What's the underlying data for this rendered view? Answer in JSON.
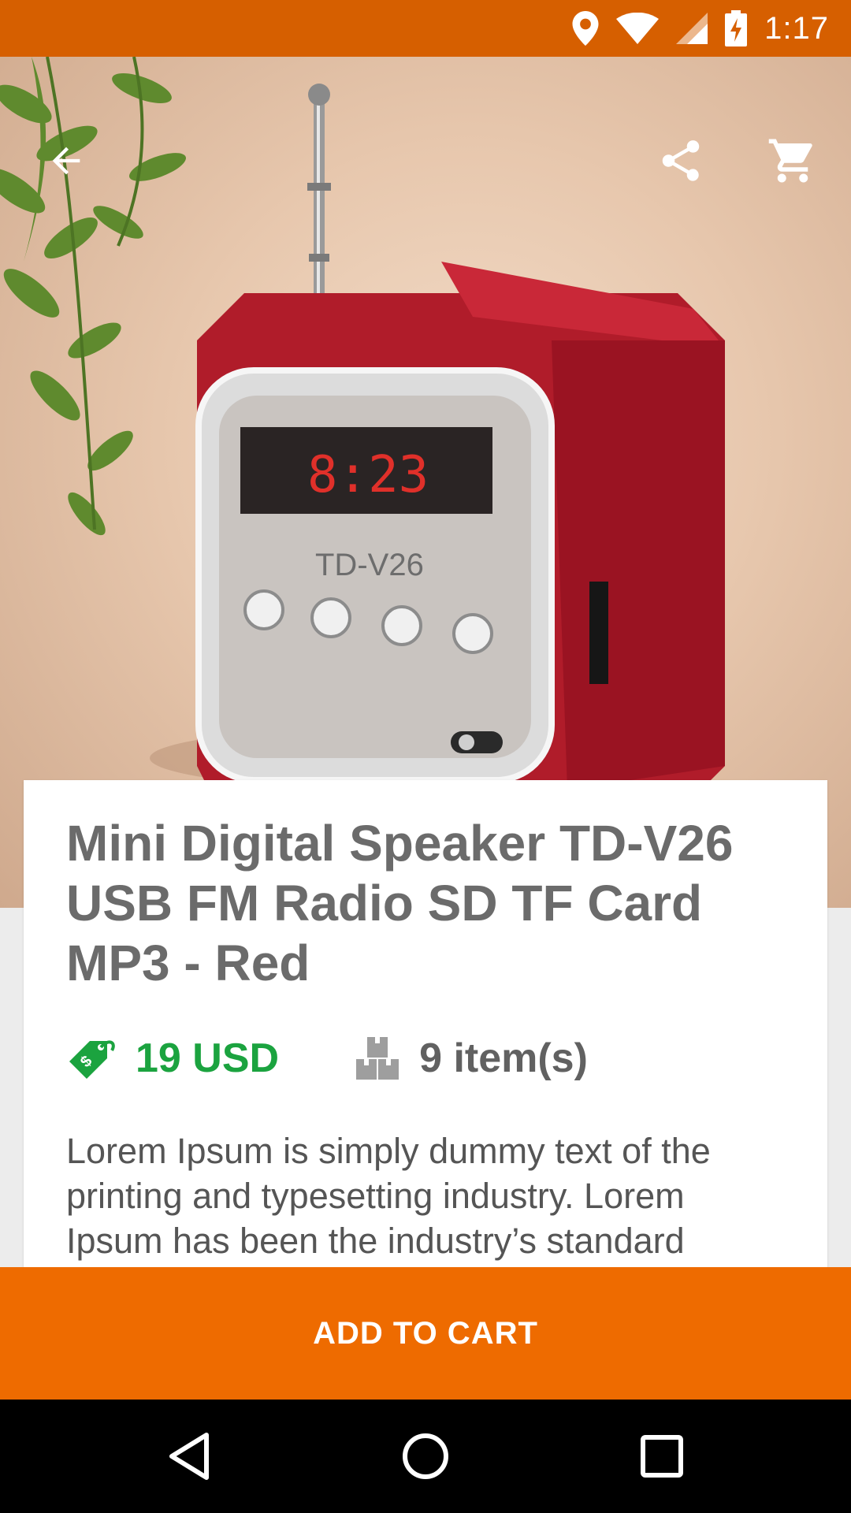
{
  "status_bar": {
    "time": "1:17",
    "icons": [
      "location-icon",
      "wifi-icon",
      "signal-icon",
      "battery-charging-icon"
    ]
  },
  "toolbar": {
    "back_icon": "arrow-back-icon",
    "share_icon": "share-icon",
    "cart_icon": "shopping-cart-icon"
  },
  "product": {
    "image_device_label": "TD-V26",
    "title": "Mini Digital Speaker TD-V26 USB FM Radio SD TF Card MP3 - Red",
    "price": "19 USD",
    "price_color": "#1ba33f",
    "stock": "9 item(s)",
    "description": "Lorem Ipsum is simply dummy text of the printing and typesetting industry. Lorem Ipsum has been the industry’s standard"
  },
  "actions": {
    "add_to_cart_label": "ADD TO CART",
    "accent_color": "#ee6b00"
  },
  "nav": {
    "buttons": [
      "back-nav-icon",
      "home-nav-icon",
      "recents-nav-icon"
    ]
  }
}
